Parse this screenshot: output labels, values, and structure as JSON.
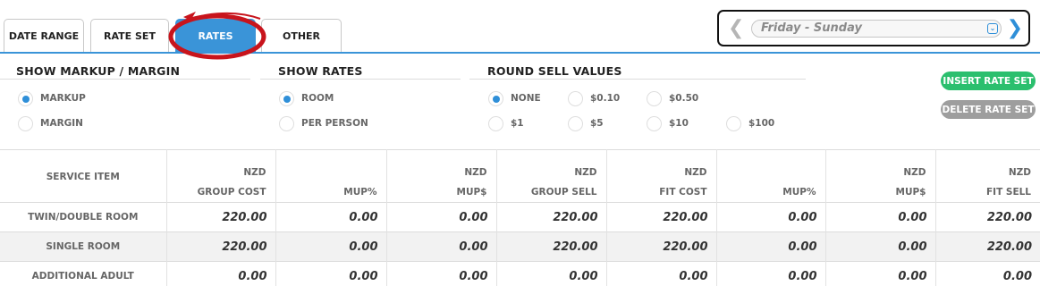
{
  "tabs": [
    {
      "label": "DATE RANGE",
      "active": false
    },
    {
      "label": "RATE SET",
      "active": false
    },
    {
      "label": "RATES",
      "active": true
    },
    {
      "label": "OTHER",
      "active": false
    }
  ],
  "date_selector": {
    "prev_icon": "chevron-left-icon",
    "next_icon": "chevron-right-icon",
    "selected": "Friday - Sunday"
  },
  "markup_margin": {
    "title": "SHOW MARKUP / MARGIN",
    "options": [
      {
        "label": "MARKUP",
        "checked": true
      },
      {
        "label": "MARGIN",
        "checked": false
      }
    ]
  },
  "show_rates": {
    "title": "SHOW RATES",
    "options": [
      {
        "label": "ROOM",
        "checked": true
      },
      {
        "label": "PER PERSON",
        "checked": false
      }
    ]
  },
  "round_sell": {
    "title": "ROUND SELL VALUES",
    "options": [
      {
        "label": "NONE",
        "checked": true
      },
      {
        "label": "$0.10",
        "checked": false
      },
      {
        "label": "$0.50",
        "checked": false
      },
      {
        "label": "$1",
        "checked": false
      },
      {
        "label": "$5",
        "checked": false
      },
      {
        "label": "$10",
        "checked": false
      },
      {
        "label": "$100",
        "checked": false
      }
    ]
  },
  "actions": {
    "insert_label": "INSERT RATE SET",
    "delete_label": "DELETE RATE SET"
  },
  "table": {
    "columns": [
      {
        "line1": "",
        "line2": "SERVICE ITEM"
      },
      {
        "line1": "NZD",
        "line2": "GROUP COST"
      },
      {
        "line1": "",
        "line2": "MUP%"
      },
      {
        "line1": "NZD",
        "line2": "MUP$"
      },
      {
        "line1": "NZD",
        "line2": "GROUP SELL"
      },
      {
        "line1": "NZD",
        "line2": "FIT COST"
      },
      {
        "line1": "",
        "line2": "MUP%"
      },
      {
        "line1": "NZD",
        "line2": "MUP$"
      },
      {
        "line1": "NZD",
        "line2": "FIT SELL"
      }
    ],
    "rows": [
      {
        "item": "TWIN/DOUBLE ROOM",
        "values": [
          "220.00",
          "0.00",
          "0.00",
          "220.00",
          "220.00",
          "0.00",
          "0.00",
          "220.00"
        ]
      },
      {
        "item": "SINGLE ROOM",
        "values": [
          "220.00",
          "0.00",
          "0.00",
          "220.00",
          "220.00",
          "0.00",
          "0.00",
          "220.00"
        ]
      },
      {
        "item": "ADDITIONAL ADULT",
        "values": [
          "0.00",
          "0.00",
          "0.00",
          "0.00",
          "0.00",
          "0.00",
          "0.00",
          "0.00"
        ]
      }
    ]
  },
  "colors": {
    "accent": "#3a94d8",
    "insert_button": "#2bbf6e",
    "delete_button": "#9e9e9e",
    "annotation": "#c8141c"
  }
}
